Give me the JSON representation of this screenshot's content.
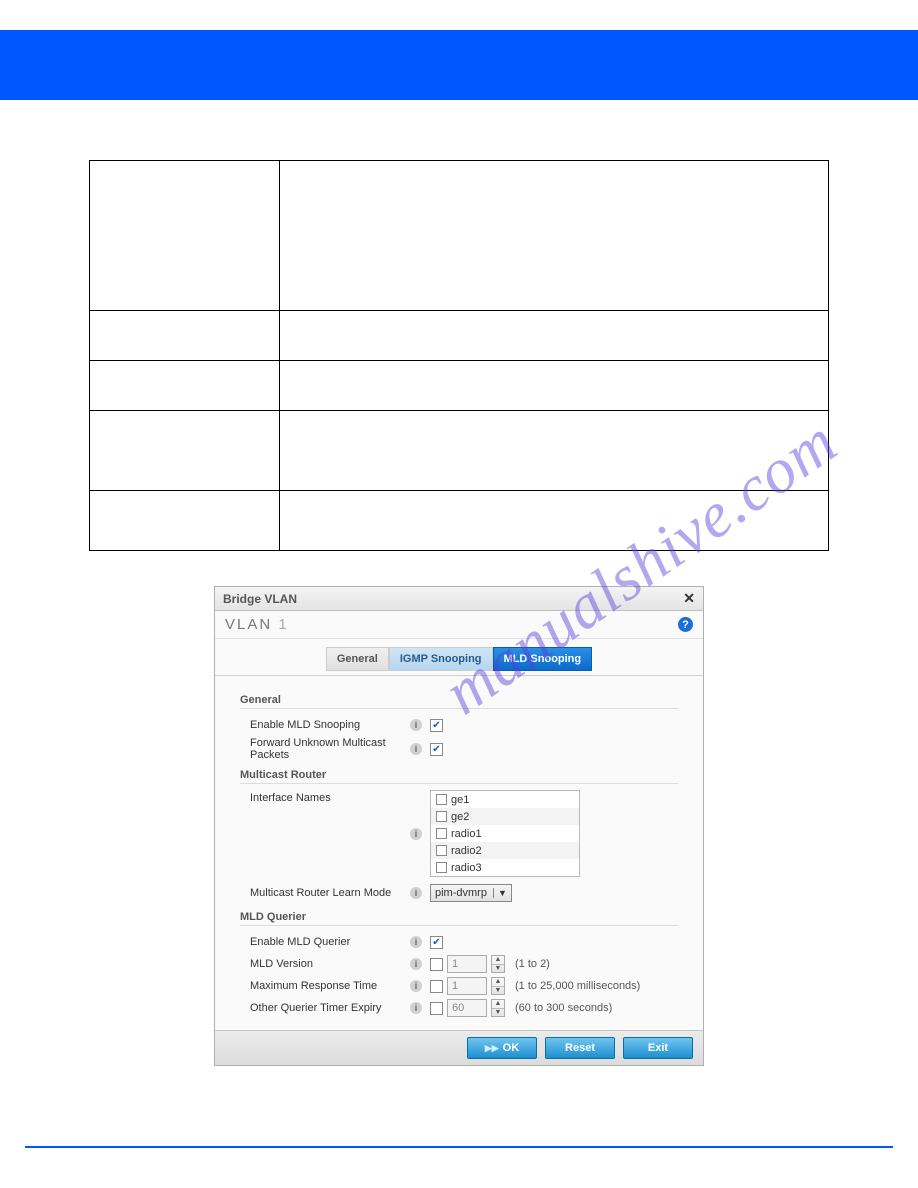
{
  "watermark": "manualshive.com",
  "dialog": {
    "title": "Bridge VLAN",
    "subtitle_label": "VLAN",
    "subtitle_value": "1",
    "tabs": {
      "general": "General",
      "igmp": "IGMP Snooping",
      "mld": "MLD Snooping"
    },
    "sections": {
      "general": {
        "heading": "General",
        "enable_mld": "Enable MLD Snooping",
        "forward_unknown": "Forward Unknown Multicast Packets"
      },
      "mrouter": {
        "heading": "Multicast Router",
        "iface_label": "Interface Names",
        "interfaces": [
          "ge1",
          "ge2",
          "radio1",
          "radio2",
          "radio3"
        ],
        "learn_mode_label": "Multicast Router Learn Mode",
        "learn_mode_value": "pim-dvmrp"
      },
      "querier": {
        "heading": "MLD Querier",
        "enable_label": "Enable MLD Querier",
        "version_label": "MLD Version",
        "version_value": "1",
        "version_hint": "(1 to 2)",
        "mrt_label": "Maximum Response Time",
        "mrt_value": "1",
        "mrt_hint": "(1 to 25,000 milliseconds)",
        "oqt_label": "Other Querier Timer Expiry",
        "oqt_value": "60",
        "oqt_hint": "(60 to 300 seconds)"
      }
    },
    "buttons": {
      "ok": "OK",
      "reset": "Reset",
      "exit": "Exit"
    }
  }
}
